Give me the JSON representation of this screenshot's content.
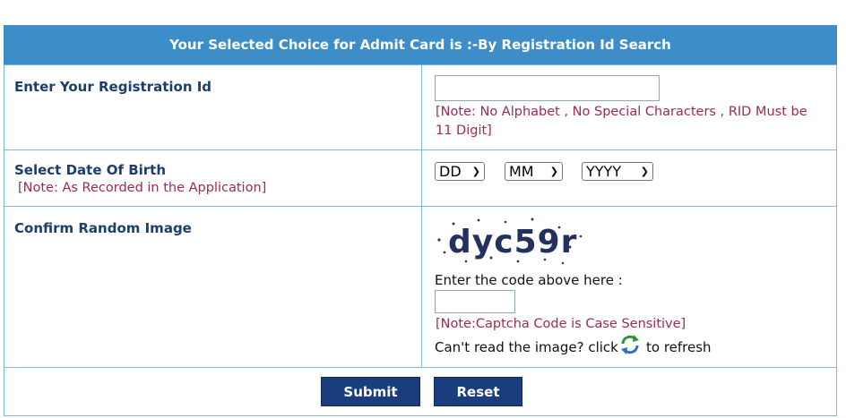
{
  "header": {
    "title": "Your Selected Choice for Admit Card is :-By Registration Id Search"
  },
  "registration": {
    "label": "Enter Your Registration Id",
    "value": "",
    "note": "[Note: No Alphabet , No Special Characters , RID Must be 11 Digit]"
  },
  "dob": {
    "label": "Select Date Of Birth",
    "note": "[Note: As Recorded in the Application]",
    "day": "DD",
    "month": "MM",
    "year": "YYYY"
  },
  "captcha": {
    "label": "Confirm Random Image",
    "image_text": "dyc59r",
    "prompt": "Enter the code above here :",
    "value": "",
    "note": "[Note:Captcha Code is Case Sensitive]",
    "refresh_prefix": "Can't read the image? click",
    "refresh_suffix": "to refresh",
    "refresh_icon": "refresh-icon"
  },
  "buttons": {
    "submit": "Submit",
    "reset": "Reset"
  },
  "colors": {
    "header_bg": "#3d8ec8",
    "label": "#1d3d6e",
    "note": "#a0294f",
    "button_bg": "#1a3d7e",
    "border": "#7fb8dd"
  }
}
